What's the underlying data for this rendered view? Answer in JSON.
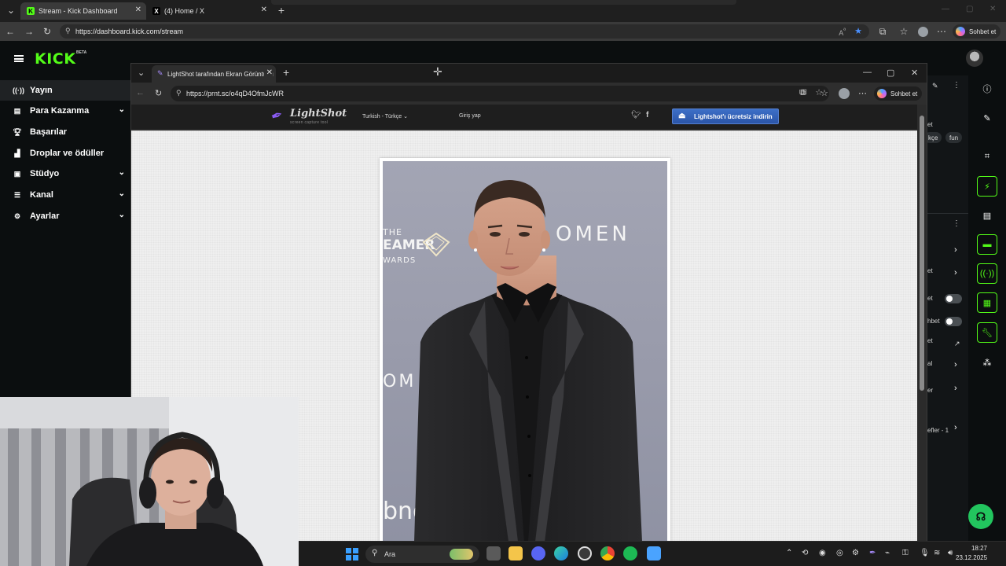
{
  "outer_browser": {
    "tabs": [
      {
        "title": "Stream - Kick Dashboard",
        "active": true
      },
      {
        "title": "(4) Home / X",
        "active": false
      }
    ],
    "new_tab": "+",
    "url": "https://dashboard.kick.com/stream",
    "chat_button": "Sohbet et"
  },
  "kick": {
    "logo": "KICK",
    "beta": "BETA",
    "sidebar": [
      {
        "label": "Yayın",
        "icon": "stream-icon",
        "active": true,
        "chevron": false
      },
      {
        "label": "Para Kazanma",
        "icon": "money-icon",
        "active": false,
        "chevron": true
      },
      {
        "label": "Başarılar",
        "icon": "trophy-icon",
        "active": false,
        "chevron": false
      },
      {
        "label": "Droplar ve ödüller",
        "icon": "drops-icon",
        "active": false,
        "chevron": false
      },
      {
        "label": "Stüdyo",
        "icon": "studio-icon",
        "active": false,
        "chevron": true
      },
      {
        "label": "Kanal",
        "icon": "channel-icon",
        "active": false,
        "chevron": true
      },
      {
        "label": "Ayarlar",
        "icon": "settings-icon",
        "active": false,
        "chevron": true
      }
    ],
    "right_panel": {
      "frag_1": "et",
      "pill_1": "kçe",
      "pill_2": "fun",
      "frag_2": "et",
      "frag_3": "et",
      "frag_4": "hbet",
      "frag_5": "et",
      "frag_6": "al",
      "frag_7": "er",
      "frag_8": "efler - 1"
    }
  },
  "inner_browser": {
    "tab_title": "LightShot tarafından Ekran Görüntüsü",
    "new_tab": "+",
    "url": "https://prnt.sc/o4qD4OfmJcWR",
    "chat_button": "Sohbet et"
  },
  "lightshot": {
    "logo": "LightShot",
    "logo_sub": "screen capture tool",
    "language": "Turkish - Türkçe",
    "login": "Giriş yap",
    "download_button": "Lightshot'ı ücretsiz indirin"
  },
  "photo": {
    "text_the": "THE",
    "text_eamer": "EAMER",
    "text_wards": "WARDS",
    "text_omen": "OMEN",
    "text_om": "OM",
    "text_bno": "bno"
  },
  "taskbar": {
    "search_placeholder": "Ara",
    "time": "18:27",
    "date": "23.12.2025"
  }
}
